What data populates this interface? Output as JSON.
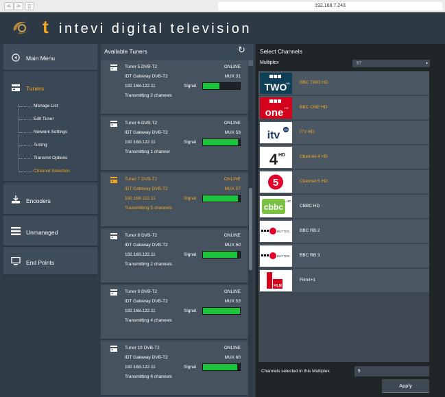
{
  "browser": {
    "back": "<",
    "forward": ">",
    "url": "192.168.7.243"
  },
  "header": {
    "logo_text": "t",
    "brand": "intevi digital television",
    "accent_color": "#f5a623"
  },
  "left_nav": {
    "main_menu": "Main Menu",
    "tuners": "Tuners",
    "sub_items": [
      "Manage List",
      "Edit Tuner",
      "Network Settings",
      "Tuning",
      "Transmit Options",
      "Channel Selection"
    ],
    "active_sub_item": "Channel Selection",
    "encoders": "Encoders",
    "unmanaged": "Unmanaged",
    "end_points": "End Points"
  },
  "tuners_panel": {
    "title": "Available Tuners",
    "signal_label": "Signal",
    "tuners": [
      {
        "name": "Tuner 5 DVB-T2",
        "status": "ONLINE",
        "gateway": "IDT Gateway  DVB-T2",
        "mux": "MUX 31",
        "ip": "192.168.122.11",
        "signal": 0.45,
        "transmitting": "Transmitting 2 channels",
        "selected": false
      },
      {
        "name": "Tuner 6 DVB-T2",
        "status": "ONLINE",
        "gateway": "IDT Gateway  DVB-T2",
        "mux": "MUX 59",
        "ip": "192.168.122.11",
        "signal": 0.95,
        "transmitting": "Transmitting 1 channel",
        "selected": false
      },
      {
        "name": "Tuner 7 DVB-T2",
        "status": "ONLINE",
        "gateway": "IDT Gateway  DVB-T2",
        "mux": "MUX 57",
        "ip": "192.168.122.11",
        "signal": 0.95,
        "transmitting": "Transmitting 5 channels",
        "selected": true
      },
      {
        "name": "Tuner 8 DVB-T2",
        "status": "ONLINE",
        "gateway": "IDT Gateway  DVB-T2",
        "mux": "MUX 50",
        "ip": "192.168.122.11",
        "signal": 0.92,
        "transmitting": "Transmitting 2 channels",
        "selected": false
      },
      {
        "name": "Tuner 9 DVB-T2",
        "status": "ONLINE",
        "gateway": "IDT Gateway  DVB-T2",
        "mux": "MUX 53",
        "ip": "192.168.122.11",
        "signal": 1.0,
        "transmitting": "Transmitting 4 channels",
        "selected": false
      },
      {
        "name": "Tuner 10 DVB-T2",
        "status": "ONLINE",
        "gateway": "IDT Gateway  DVB-T2",
        "mux": "MUX 60",
        "ip": "192.168.122.11",
        "signal": 0.92,
        "transmitting": "Transmitting 6 channels",
        "selected": false
      }
    ]
  },
  "channels_panel": {
    "title": "Select Channels",
    "multiplex_label": "Multiplex",
    "multiplex_value": "57",
    "channels": [
      {
        "name": "BBC TWO HD",
        "selected": true,
        "logo": "bbc-two-hd-logo",
        "logo_text": "TWO",
        "logo_top": "BBC"
      },
      {
        "name": "BBC ONE HD",
        "selected": true,
        "logo": "bbc-one-hd-logo",
        "logo_text": "one",
        "logo_top": "BBC"
      },
      {
        "name": "ITV HD",
        "selected": true,
        "logo": "itv-hd-logo",
        "logo_text": "itv",
        "logo_top": "HD"
      },
      {
        "name": "Channel 4 HD",
        "selected": true,
        "logo": "channel-4-hd-logo",
        "logo_text": "4",
        "logo_top": "HD"
      },
      {
        "name": "Channel 5 HD",
        "selected": true,
        "logo": "channel-5-hd-logo",
        "logo_text": "5",
        "logo_top": ""
      },
      {
        "name": "CBBC HD",
        "selected": false,
        "logo": "cbbc-hd-logo",
        "logo_text": "cbbc",
        "logo_top": "HD"
      },
      {
        "name": "BBC RB 2",
        "selected": false,
        "logo": "bbc-red-button-logo",
        "logo_text": "BUTTON",
        "logo_top": "BBC"
      },
      {
        "name": "BBC RB 3",
        "selected": false,
        "logo": "bbc-red-button-logo",
        "logo_text": "BUTTON",
        "logo_top": "BBC"
      },
      {
        "name": "Film4+1",
        "selected": false,
        "logo": "film4-logo",
        "logo_text": "FILM",
        "logo_top": ""
      }
    ],
    "selected_label": "Channels selected in this Multiplex",
    "selected_count": "5",
    "apply": "Apply"
  }
}
